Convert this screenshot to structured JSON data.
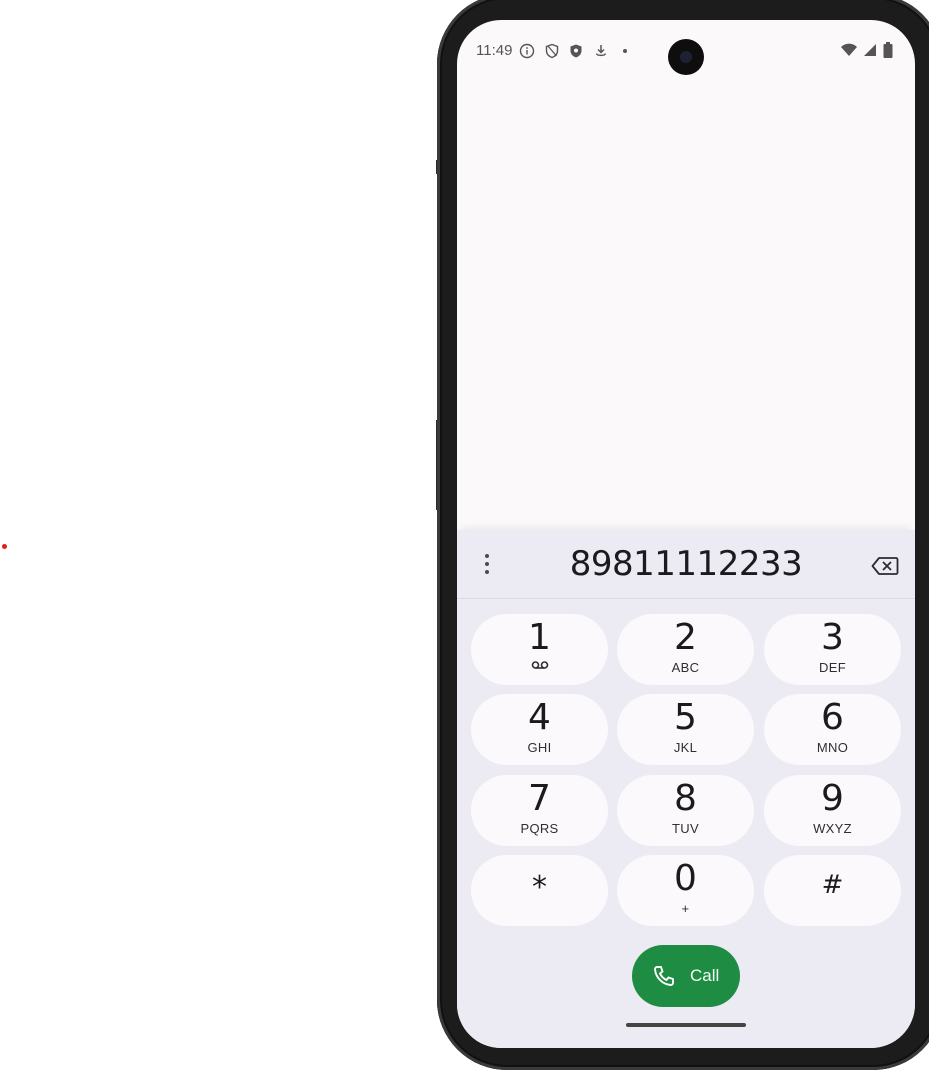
{
  "status_bar": {
    "time": "11:49",
    "left_icons": [
      "info-icon",
      "shield-outline-icon",
      "shield-filled-icon",
      "download-icon",
      "dot-icon"
    ],
    "right_icons": [
      "wifi-icon",
      "cellular-signal-icon",
      "battery-icon"
    ]
  },
  "dialer": {
    "number": "89811112233",
    "menu_icon": "more-vertical-icon",
    "backspace_icon": "backspace-icon",
    "keys": [
      {
        "digit": "1",
        "letters": "",
        "sub_icon": "voicemail-icon"
      },
      {
        "digit": "2",
        "letters": "ABC"
      },
      {
        "digit": "3",
        "letters": "DEF"
      },
      {
        "digit": "4",
        "letters": "GHI"
      },
      {
        "digit": "5",
        "letters": "JKL"
      },
      {
        "digit": "6",
        "letters": "MNO"
      },
      {
        "digit": "7",
        "letters": "PQRS"
      },
      {
        "digit": "8",
        "letters": "TUV"
      },
      {
        "digit": "9",
        "letters": "WXYZ"
      },
      {
        "digit": "*",
        "letters": ""
      },
      {
        "digit": "0",
        "letters": "+"
      },
      {
        "digit": "#",
        "letters": ""
      }
    ],
    "call_label": "Call",
    "call_icon": "phone-icon"
  },
  "colors": {
    "call_button": "#1e8c43",
    "dialer_background": "#ecebf3",
    "key_background": "#fcf9fd"
  }
}
